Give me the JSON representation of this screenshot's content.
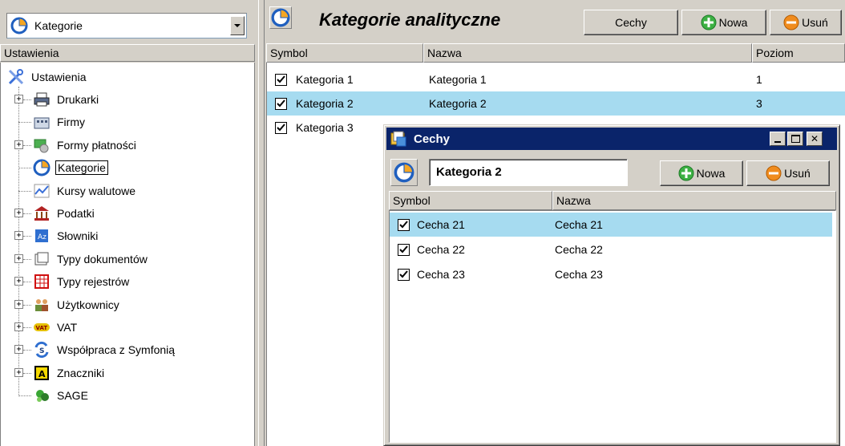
{
  "left": {
    "combo_value": "Kategorie",
    "tree_header": "Ustawienia",
    "tree": {
      "root": "Ustawienia",
      "items": [
        {
          "label": "Drukarki",
          "icon": "printer-icon",
          "expandable": true
        },
        {
          "label": "Firmy",
          "icon": "company-icon",
          "expandable": false
        },
        {
          "label": "Formy płatności",
          "icon": "payment-icon",
          "expandable": true
        },
        {
          "label": "Kategorie",
          "icon": "pie-chart-icon",
          "expandable": false,
          "selected": true
        },
        {
          "label": "Kursy walutowe",
          "icon": "exchange-chart-icon",
          "expandable": false
        },
        {
          "label": "Podatki",
          "icon": "tax-building-icon",
          "expandable": true
        },
        {
          "label": "Słowniki",
          "icon": "dictionary-icon",
          "expandable": true
        },
        {
          "label": "Typy dokumentów",
          "icon": "document-types-icon",
          "expandable": true
        },
        {
          "label": "Typy rejestrów",
          "icon": "register-grid-icon",
          "expandable": true
        },
        {
          "label": "Użytkownicy",
          "icon": "users-icon",
          "expandable": true
        },
        {
          "label": "VAT",
          "icon": "vat-icon",
          "icon_text": "VAT",
          "expandable": true
        },
        {
          "label": "Współpraca z Symfonią",
          "icon": "sync-icon",
          "expandable": true
        },
        {
          "label": "Znaczniki",
          "icon": "marker-icon",
          "icon_text": "A",
          "expandable": true
        },
        {
          "label": "SAGE",
          "icon": "sage-icon",
          "expandable": false
        }
      ]
    }
  },
  "right": {
    "title": "Kategorie analityczne",
    "buttons": {
      "cechy": "Cechy",
      "nowa": "Nowa",
      "usun": "Usuń"
    },
    "columns": [
      "Symbol",
      "Nazwa",
      "Poziom"
    ],
    "rows": [
      {
        "symbol": "Kategoria 1",
        "nazwa": "Kategoria 1",
        "poziom": "1",
        "checked": true,
        "selected": false
      },
      {
        "symbol": "Kategoria 2",
        "nazwa": "Kategoria 2",
        "poziom": "3",
        "checked": true,
        "selected": true
      },
      {
        "symbol": "Kategoria 3",
        "nazwa": "",
        "poziom": "",
        "checked": true,
        "selected": false
      }
    ]
  },
  "dialog": {
    "title": "Cechy",
    "field_value": "Kategoria 2",
    "buttons": {
      "nowa": "Nowa",
      "usun": "Usuń"
    },
    "columns": [
      "Symbol",
      "Nazwa"
    ],
    "rows": [
      {
        "symbol": "Cecha 21",
        "nazwa": "Cecha 21",
        "checked": true,
        "selected": true
      },
      {
        "symbol": "Cecha 22",
        "nazwa": "Cecha 22",
        "checked": true,
        "selected": false
      },
      {
        "symbol": "Cecha 23",
        "nazwa": "Cecha 23",
        "checked": true,
        "selected": false
      }
    ]
  },
  "colors": {
    "selection": "#a6dbf0",
    "titlebar": "#0a246a",
    "face": "#d4d0c8",
    "add_green": "#3cb043",
    "remove_orange": "#f08c1e"
  }
}
